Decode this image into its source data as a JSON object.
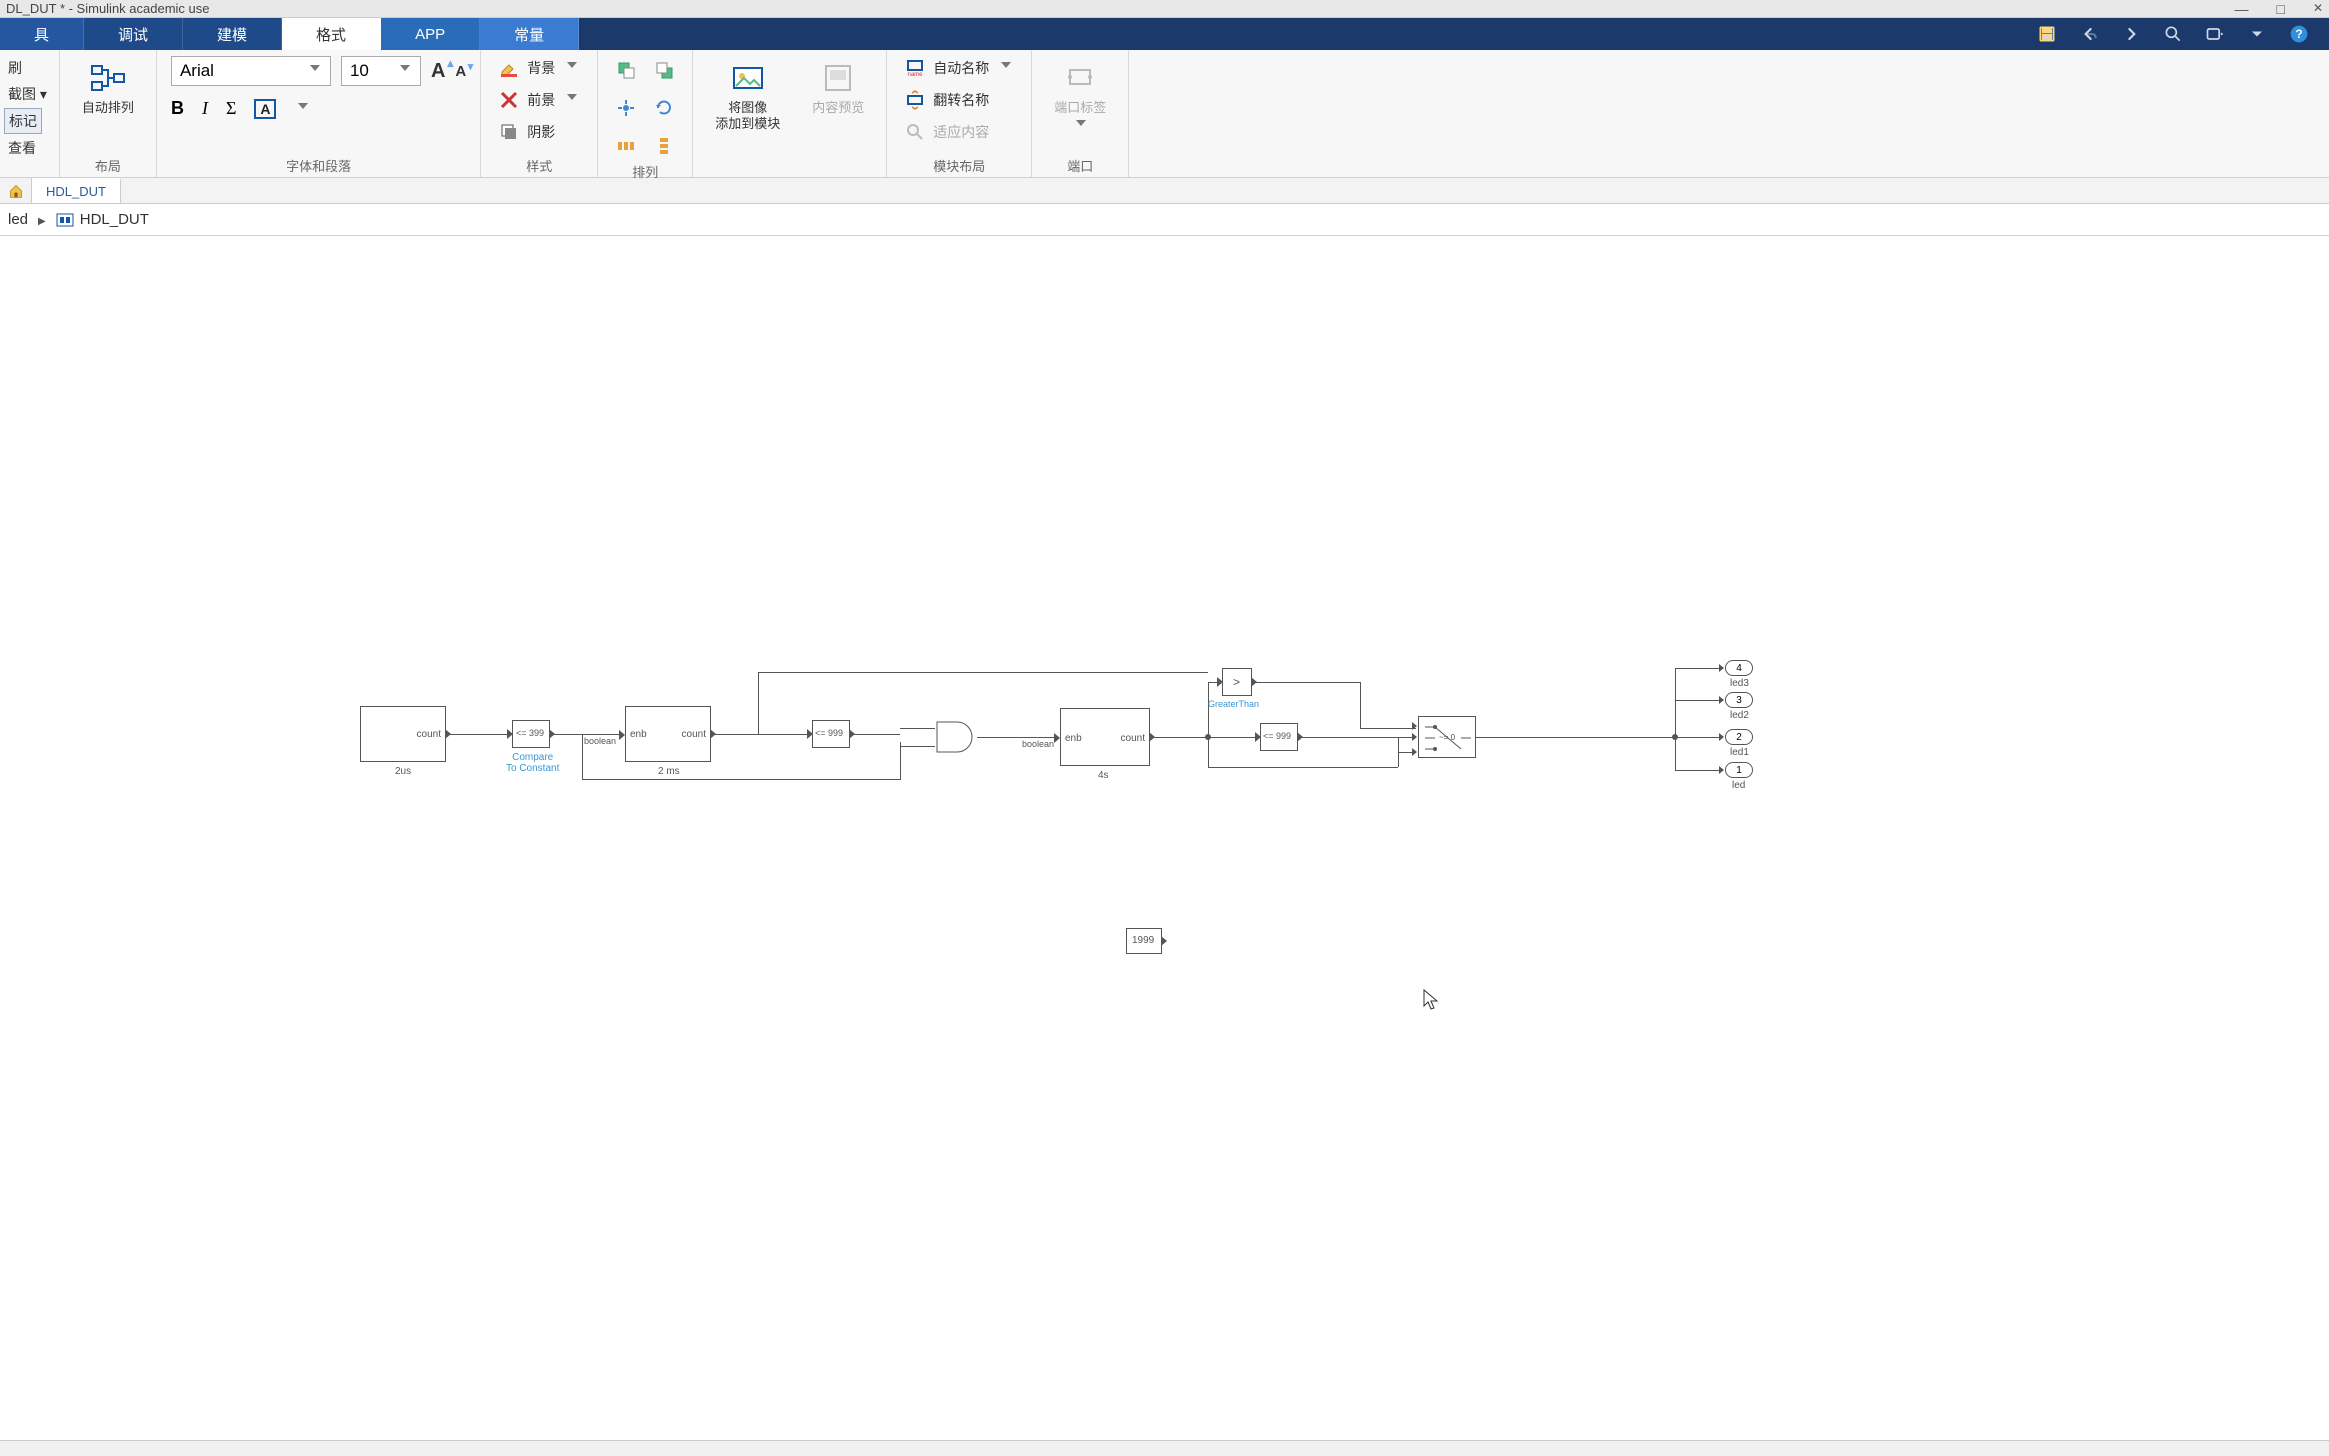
{
  "title": "DL_DUT * - Simulink academic use",
  "window_controls": {
    "min": "—",
    "max": "□",
    "close": "✕"
  },
  "tabs": {
    "t1": "具",
    "t2": "调试",
    "t3": "建模",
    "t4": "格式",
    "t5": "APP",
    "t6": "常量"
  },
  "group_labels": {
    "g0": "刷",
    "g1": "布局",
    "g2": "字体和段落",
    "g3": "样式",
    "g4": "排列",
    "g5": "将图像\n添加到模块",
    "g6": "模块布局",
    "g7": "端口"
  },
  "ribbon": {
    "left": {
      "btn1": "刷",
      "btn2_row1": "截图 ▾",
      "btn3": "标记",
      "btn4": "查看"
    },
    "layout": {
      "auto": "自动排列"
    },
    "font": {
      "family": "Arial",
      "size": "10"
    },
    "style": {
      "bg": "背景",
      "fg": "前景",
      "shadow": "阴影"
    },
    "image": {
      "label": "将图像\n添加到模块",
      "preview": "内容预览"
    },
    "blocklayout": {
      "autoname": "自动名称",
      "flipname": "翻转名称",
      "fit": "适应内容"
    },
    "port": {
      "label": "端口标签"
    }
  },
  "subtab": "HDL_DUT",
  "breadcrumb": {
    "root": "led",
    "child": "HDL_DUT"
  },
  "canvas": {
    "blk_2us": {
      "label": "2us",
      "port": "count"
    },
    "cmp1": {
      "txt": "<= 399",
      "name": "Compare\nTo Constant"
    },
    "dtc1": "boolean",
    "blk_2ms": {
      "label": "2 ms",
      "enb": "enb",
      "count": "count"
    },
    "cmp2": "<= 999",
    "and": "",
    "dtc2": "boolean",
    "blk_4s": {
      "label": "4s",
      "enb": "enb",
      "count": "count"
    },
    "gt": {
      "sym": ">",
      "name": "GreaterThan"
    },
    "cmp3": "<= 999",
    "switch_txt": "~= 0",
    "const": "1999",
    "out1": {
      "n": "1",
      "name": "led"
    },
    "out2": {
      "n": "2",
      "name": "led1"
    },
    "out3": {
      "n": "3",
      "name": "led2"
    },
    "out4": {
      "n": "4",
      "name": "led3"
    }
  }
}
